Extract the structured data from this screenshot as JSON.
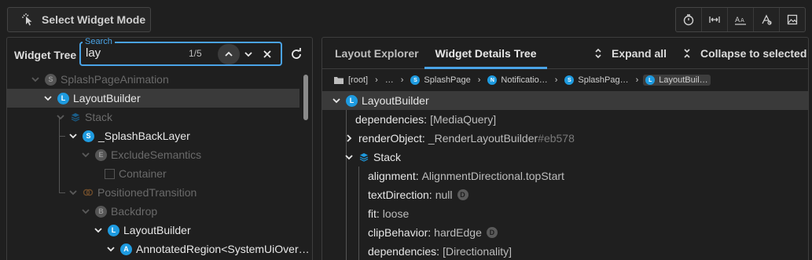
{
  "toolbar": {
    "select_widget_mode": "Select Widget Mode",
    "icons": [
      "timer-icon",
      "width-icon",
      "text-scale-icon",
      "baseline-icon",
      "image-icon"
    ]
  },
  "widget_tree": {
    "title": "Widget Tree",
    "search": {
      "legend": "Search",
      "value": "lay",
      "match_count": "1/5"
    },
    "rows": [
      {
        "label": "SplashPageAnimation",
        "badge": "S"
      },
      {
        "label": "LayoutBuilder",
        "badge": "L"
      },
      {
        "label": "Stack"
      },
      {
        "label": "_SplashBackLayer",
        "badge": "S"
      },
      {
        "label": "ExcludeSemantics",
        "badge": "E"
      },
      {
        "label": "Container"
      },
      {
        "label": "PositionedTransition"
      },
      {
        "label": "Backdrop",
        "badge": "B"
      },
      {
        "label": "LayoutBuilder",
        "badge": "L"
      },
      {
        "label": "AnnotatedRegion<SystemUiOver…",
        "badge": "A"
      }
    ]
  },
  "details": {
    "tabs": [
      "Layout Explorer",
      "Widget Details Tree"
    ],
    "active_tab": "Widget Details Tree",
    "expand_all": "Expand all",
    "collapse_selected": "Collapse to selected",
    "breadcrumb": [
      {
        "label": "[root]"
      },
      {
        "label": "…"
      },
      {
        "label": "SplashPage",
        "badge": "S"
      },
      {
        "label": "Notificatio…",
        "badge": "N"
      },
      {
        "label": "SplashPag…",
        "badge": "S"
      },
      {
        "label": "LayoutBuil…",
        "badge": "L"
      }
    ],
    "rows": [
      {
        "key": "LayoutBuilder",
        "badge": "L"
      },
      {
        "key": "dependencies:",
        "value": "[MediaQuery]"
      },
      {
        "key": "renderObject:",
        "value": "_RenderLayoutBuilder",
        "hash": "#eb578"
      },
      {
        "key": "Stack"
      },
      {
        "key": "alignment:",
        "value": "AlignmentDirectional.topStart"
      },
      {
        "key": "textDirection:",
        "value": "null",
        "default_badge": "D"
      },
      {
        "key": "fit:",
        "value": "loose"
      },
      {
        "key": "clipBehavior:",
        "value": "hardEdge",
        "default_badge": "D"
      },
      {
        "key": "dependencies:",
        "value": "[Directionality]"
      }
    ]
  },
  "colors": {
    "background": "#1f1f1f",
    "accent": "#4aa3e6",
    "badge": "#1e9be0",
    "selected_row": "#3a3a3a"
  }
}
